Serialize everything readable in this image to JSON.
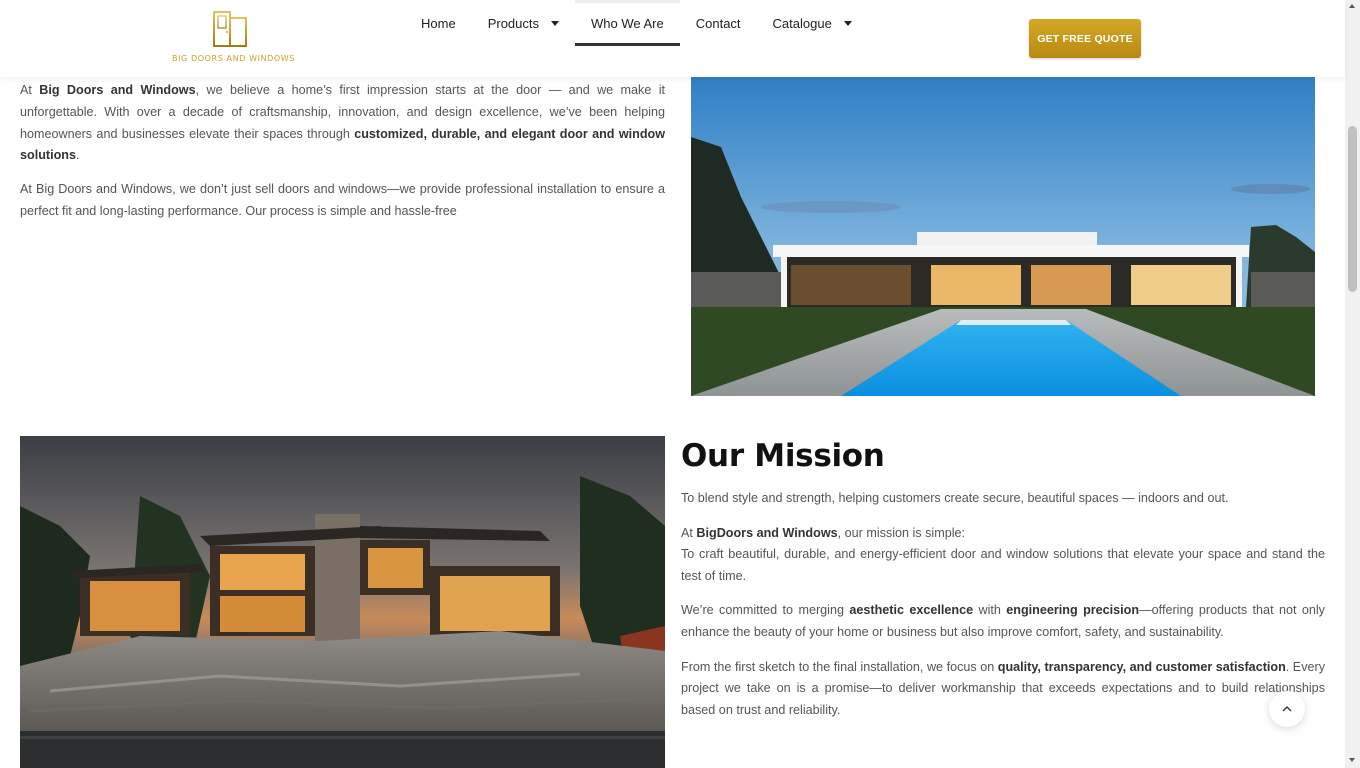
{
  "brand": {
    "name": "BIG DOORS AND WINDOWS",
    "accent": "#c9a227"
  },
  "nav": {
    "items": [
      {
        "label": "Home",
        "dropdown": false,
        "active": false
      },
      {
        "label": "Products",
        "dropdown": true,
        "active": false
      },
      {
        "label": "Who We Are",
        "dropdown": false,
        "active": true
      },
      {
        "label": "Contact",
        "dropdown": false,
        "active": false
      },
      {
        "label": "Catalogue",
        "dropdown": true,
        "active": false
      }
    ],
    "cta": "GET FREE QUOTE"
  },
  "intro": {
    "p1": {
      "t1": "At ",
      "b1": "Big Doors and Windows",
      "t2": ", we believe a home’s first impression starts at the door — and we make it unforgettable. With over a decade of craftsmanship, innovation, and design excellence, we’ve been helping homeowners and businesses elevate their spaces through ",
      "b2": "customized, durable, and elegant door and window solutions",
      "t3": "."
    },
    "p2": "At Big Doors and Windows, we don’t just sell doors and windows—we provide professional installation to ensure a perfect fit and long-lasting performance. Our process is simple and hassle-free"
  },
  "mission": {
    "title": "Our Mission",
    "p1": "To blend style and strength, helping customers create secure, beautiful spaces — indoors and out.",
    "p2": {
      "t1": "At ",
      "b1": "BigDoors and Windows",
      "t2": ", our mission is simple:",
      "t3": "To craft beautiful, durable, and energy-efficient door and window solutions that elevate your space and stand the test of time."
    },
    "p3": {
      "t1": "We’re committed to merging ",
      "b1": "aesthetic excellence",
      "t2": " with ",
      "b2": "engineering precision",
      "t3": "—offering products that not only enhance the beauty of your home or business but also improve comfort, safety, and sustainability."
    },
    "p4": {
      "t1": "From the first sketch to the final installation, we focus on ",
      "b1": "quality, transparency, and customer satisfaction",
      "t2": ". Every project we take on is a promise—to deliver workmanship that exceeds expectations and to build relationships based on trust and reliability."
    }
  },
  "icons": {
    "scroll_top": "chevron-up-icon",
    "dropdown": "caret-down-icon"
  }
}
